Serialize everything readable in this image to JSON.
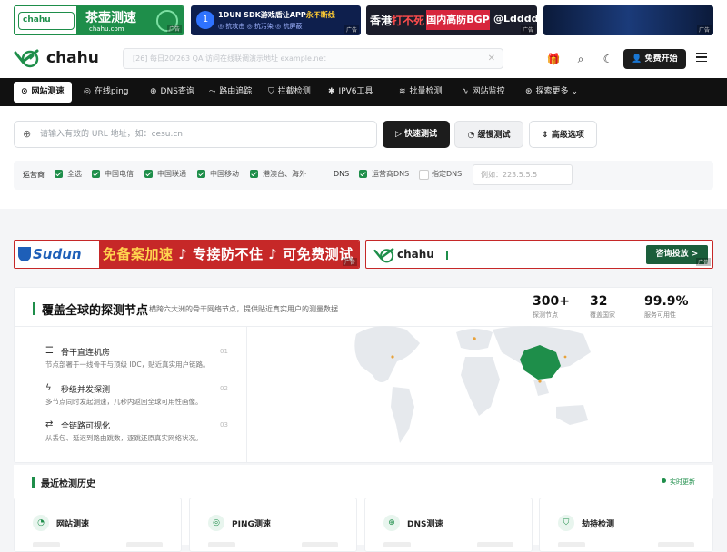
{
  "ads_top": {
    "ad1": {
      "logo": "chahu",
      "title": "茶壶测速",
      "url": "chahu.com",
      "tag": "广告"
    },
    "ad2": {
      "badge": "1",
      "title_a": "1DUN SDK游戏盾让APP",
      "title_b": "永不断线",
      "sub": "◎ 抗攻击  ◎ 抗污染  ◎ 抗屏蔽",
      "tag": "广告"
    },
    "ad3": {
      "a": "香港",
      "a_red": "打不死",
      "b": "国内高防BGP",
      "c": "@Ldddd",
      "tag": "广告"
    },
    "ad4": {
      "tag": "广告"
    }
  },
  "header": {
    "brand": "chahu",
    "ticker": "[26]  每日20/263 QA  访问在线联调演示地址 example.net",
    "start_label": "免费开始",
    "gift_icon": "gift-icon",
    "search_icon": "search-icon",
    "theme_icon": "moon-icon"
  },
  "nav": {
    "items": [
      {
        "label": "网站测速",
        "icon": "speed-icon"
      },
      {
        "label": "在线ping",
        "icon": "ping-icon"
      },
      {
        "label": "DNS查询",
        "icon": "globe-icon"
      },
      {
        "label": "路由追踪",
        "icon": "route-icon"
      },
      {
        "label": "拦截检测",
        "icon": "shield-icon"
      },
      {
        "label": "IPV6工具",
        "icon": "ipv6-icon"
      },
      {
        "label": "批量检测",
        "icon": "layers-icon"
      },
      {
        "label": "网站监控",
        "icon": "monitor-icon"
      },
      {
        "label": "探索更多",
        "icon": "compass-icon"
      }
    ]
  },
  "search": {
    "placeholder": "请输入有效的 URL 地址，如：cesu.cn",
    "fast_label": "快速测试",
    "slow_label": "缓慢测试",
    "advanced_label": "高级选项"
  },
  "options": {
    "carrier_label": "运营商",
    "carriers": [
      "全选",
      "中国电信",
      "中国联通",
      "中国移动",
      "港澳台、海外"
    ],
    "dns_label": "DNS",
    "dns_opt1": "运营商DNS",
    "dns_opt2": "指定DNS",
    "dns_placeholder": "例如：223.5.5.5"
  },
  "ads_mid": {
    "sudun_logo": "Sudun",
    "sudun_text_a": "免备案加速",
    "sudun_text_b": "专接防不住",
    "sudun_text_c": "可免费测试",
    "chahu_name": "chahu",
    "chahu_cta": "咨询投放 >",
    "tag": "广告"
  },
  "nodes": {
    "title": "覆盖全球的探测节点",
    "subtitle": "横跨六大洲的骨干网络节点，提供贴近真实用户的测量数据",
    "stats": [
      {
        "value": "300+",
        "label": "探测节点"
      },
      {
        "value": "32",
        "label": "覆盖国家"
      },
      {
        "value": "99.9%",
        "label": "服务可用性"
      }
    ],
    "features": [
      {
        "title": "骨干直连机房",
        "desc": "节点部署于一线骨干与顶级 IDC，贴近真实用户链路。",
        "num": "01",
        "icon": "server-icon"
      },
      {
        "title": "秒级并发探测",
        "desc": "多节点同时发起测速，几秒内返回全球可用性画像。",
        "num": "02",
        "icon": "bolt-icon"
      },
      {
        "title": "全链路可视化",
        "desc": "从丢包、延迟到路由跳数，逐跳还原真实网络状况。",
        "num": "03",
        "icon": "share-icon"
      }
    ]
  },
  "history": {
    "title": "最近检测历史",
    "live": "实时更新",
    "cards": [
      {
        "label": "网站测速",
        "icon": "gauge-icon"
      },
      {
        "label": "PING测速",
        "icon": "ping-icon"
      },
      {
        "label": "DNS测速",
        "icon": "globe-icon"
      },
      {
        "label": "劫持检测",
        "icon": "shield-icon"
      }
    ]
  },
  "colors": {
    "accent": "#1e8e4a",
    "dark": "#111111",
    "ad_red": "#c62828"
  }
}
